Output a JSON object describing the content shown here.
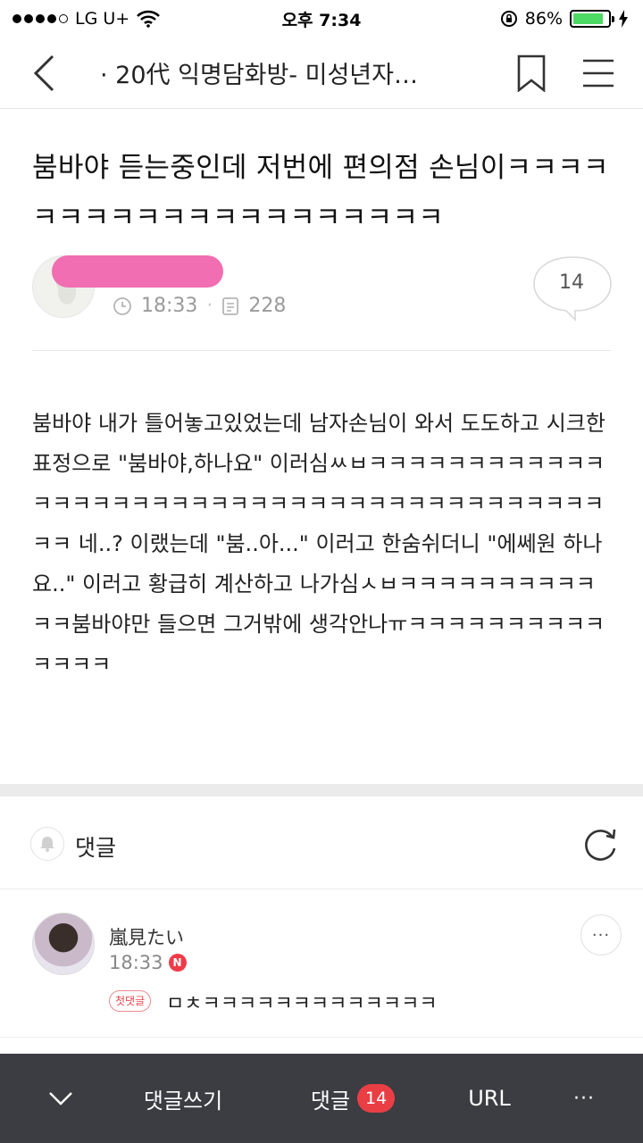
{
  "status_bar": {
    "carrier": "LG U+",
    "time": "오후 7:34",
    "battery": "86%",
    "battery_level": 0.86
  },
  "nav": {
    "title": "· 20代 익명담화방- 미성년자…"
  },
  "post": {
    "title": "붐바야 듣는중인데 저번에 편의점 손님이ㅋㅋㅋㅋㅋㅋㅋㅋㅋㅋㅋㅋㅋㅋㅋㅋㅋㅋㅋㅋ",
    "time": "18:33",
    "views": "228",
    "comment_count": "14",
    "body": "붐바야 내가 틀어놓고있었는데 남자손님이 와서 도도하고 시크한표정으로 \"붐바야,하나요\" 이러심ㅆㅂㅋㅋㅋㅋㅋㅋㅋㅋㅋㅋㅋㅋㅋㅋㅋㅋㅋㅋㅋㅋㅋㅋㅋㅋㅋㅋㅋㅋㅋㅋㅋㅋㅋㅋㅋㅋㅋㅋㅋㅋㅋㅋㅋ 네..? 이랬는데 \"붐..아...\" 이러고 한숨쉬더니 \"에쎄원 하나요..\" 이러고 황급히 계산하고 나가심ㅅㅂㅋㅋㅋㅋㅋㅋㅋㅋㅋㅋㅋㅋ붐바야만 들으면 그거밖에 생각안나ㅠㅋㅋㅋㅋㅋㅋㅋㅋㅋㅋㅋㅋㅋㅋ"
  },
  "comments_section": {
    "label": "댓글"
  },
  "comment": {
    "author": "嵐見たい",
    "time": "18:33",
    "new_badge": "N",
    "first_badge": "첫댓글",
    "text": "ㅁㅊㅋㅋㅋㅋㅋㅋㅋㅋㅋㅋㅋㅋㅋ",
    "more": "···"
  },
  "bottom_bar": {
    "write_label": "댓글쓰기",
    "comments_label": "댓글",
    "comments_count": "14",
    "url_label": "URL",
    "more": "···"
  },
  "colors": {
    "accent_red": "#ea3e45",
    "bottom_bar_bg": "#3c3d42",
    "battery_green": "#4cd964",
    "redaction_pink": "#f06eb1"
  }
}
